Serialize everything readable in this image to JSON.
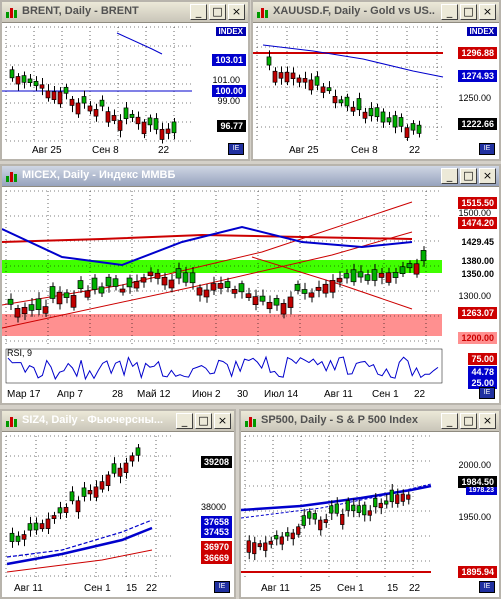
{
  "w1": {
    "title": "BRENT, Daily - BRENT",
    "index": "INDEX",
    "y": [
      "101.00",
      "99.00"
    ],
    "x": [
      "Авг 25",
      "Сен 8",
      "22"
    ],
    "labels": [
      {
        "t": "103.01",
        "bg": "#0000cc",
        "fg": "#fff"
      },
      {
        "t": "100.00",
        "bg": "#0000cc",
        "fg": "#fff"
      },
      {
        "t": "96.77",
        "bg": "#000",
        "fg": "#fff"
      }
    ]
  },
  "w2": {
    "title": "XAUUSD.F, Daily - Gold vs US...",
    "index": "INDEX",
    "y": [
      "1250.00"
    ],
    "x": [
      "Авг 25",
      "Сен 8",
      "22"
    ],
    "labels": [
      {
        "t": "1296.88",
        "bg": "#cc0000",
        "fg": "#fff"
      },
      {
        "t": "1274.93",
        "bg": "#0000cc",
        "fg": "#fff"
      },
      {
        "t": "1222.66",
        "bg": "#000",
        "fg": "#fff"
      }
    ]
  },
  "w3": {
    "title": "MICEX, Daily - Индекс ММВБ",
    "y": [
      "1500.00",
      "1300.00"
    ],
    "x": [
      "Мар 17",
      "Апр 7",
      "28",
      "Май 12",
      "Июн 2",
      "30",
      "Июл 14",
      "Авг 11",
      "Сен 1",
      "22"
    ],
    "labels": [
      {
        "t": "1515.50",
        "bg": "#cc0000",
        "fg": "#fff"
      },
      {
        "t": "1474.20",
        "bg": "#cc0000",
        "fg": "#fff"
      },
      {
        "t": "1429.45",
        "bg": "#fff",
        "fg": "#000"
      },
      {
        "t": "1380.00",
        "bg": "#fff",
        "fg": "#000"
      },
      {
        "t": "1350.00",
        "bg": "#fff",
        "fg": "#000"
      },
      {
        "t": "1263.07",
        "bg": "#cc0000",
        "fg": "#fff"
      },
      {
        "t": "1200.00",
        "bg": "#ff9090",
        "fg": "#cc0000"
      }
    ],
    "rsi": {
      "label": "RSI, 9",
      "labels": [
        {
          "t": "75.00",
          "bg": "#cc0000",
          "fg": "#fff"
        },
        {
          "t": "44.78",
          "bg": "#0000cc",
          "fg": "#fff"
        },
        {
          "t": "25.00",
          "bg": "#0000cc",
          "fg": "#fff"
        }
      ]
    }
  },
  "w4": {
    "title": "SIZ4, Daily - Фьючерсны...",
    "y": [
      "38000"
    ],
    "x": [
      "Авг 11",
      "Сен 1",
      "15",
      "22"
    ],
    "labels": [
      {
        "t": "39208",
        "bg": "#000",
        "fg": "#fff"
      },
      {
        "t": "37658",
        "bg": "#0000cc",
        "fg": "#fff"
      },
      {
        "t": "37453",
        "bg": "#0000cc",
        "fg": "#fff"
      },
      {
        "t": "36970",
        "bg": "#cc0000",
        "fg": "#fff"
      },
      {
        "t": "36669",
        "bg": "#cc0000",
        "fg": "#fff"
      }
    ]
  },
  "w5": {
    "title": "SP500, Daily - S & P 500 Index",
    "y": [
      "2000.00",
      "1950.00"
    ],
    "x": [
      "Авг 11",
      "25",
      "Сен 1",
      "15",
      "22"
    ],
    "labels": [
      {
        "t": "1984.50",
        "bg": "#000",
        "fg": "#fff"
      },
      {
        "t": "1978.23",
        "bg": "#0000cc",
        "fg": "#fff"
      },
      {
        "t": "1895.94",
        "bg": "#cc0000",
        "fg": "#fff"
      }
    ]
  },
  "icons": {
    "min": "_",
    "max": "□",
    "close": "×",
    "corner": "IE"
  }
}
